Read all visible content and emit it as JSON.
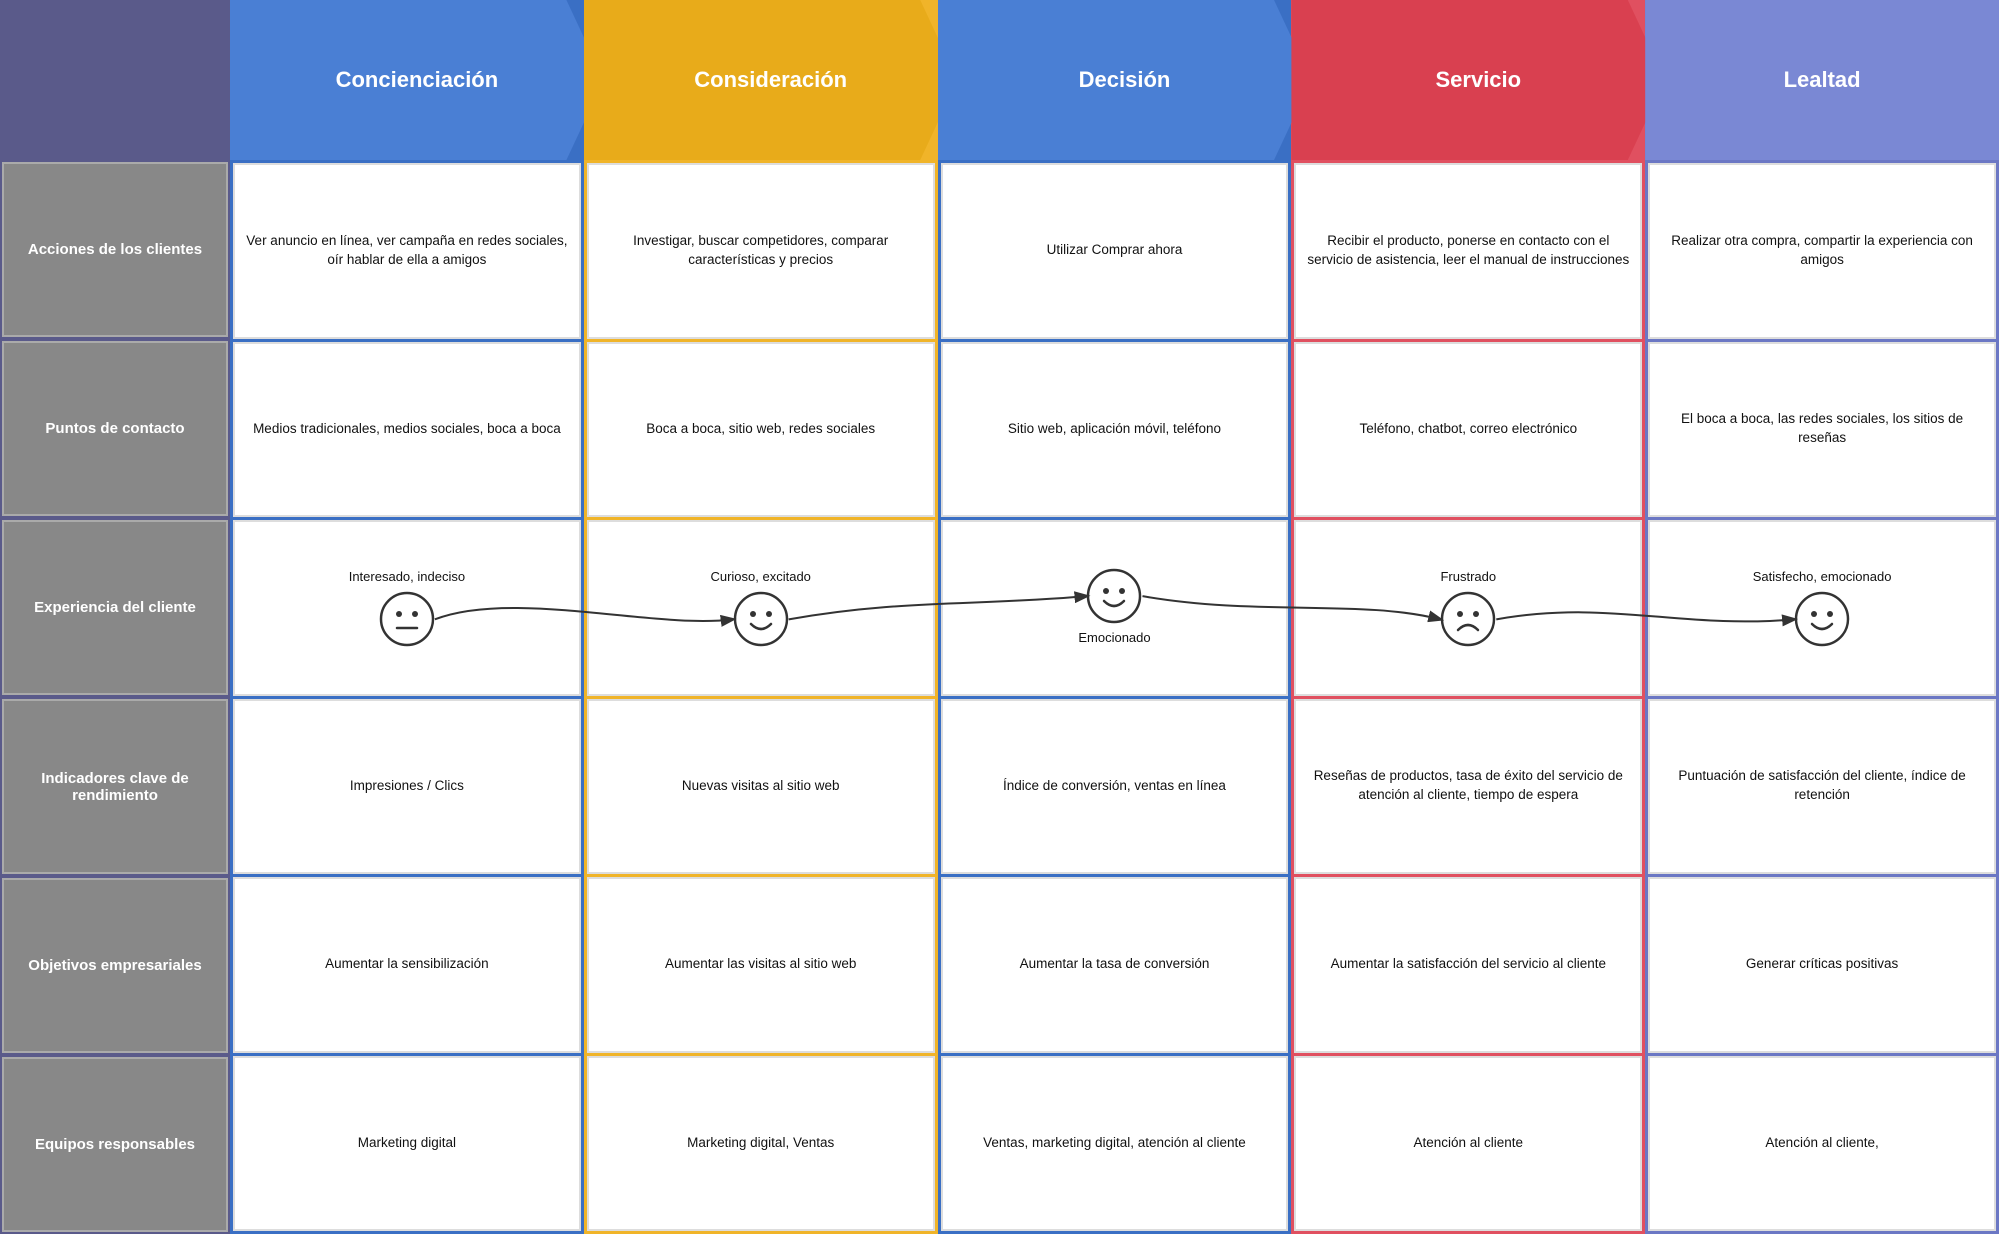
{
  "stages": [
    {
      "id": "concienciacion",
      "label": "Concienciación",
      "colorClass": "col-blue",
      "rows": {
        "acciones": "Ver anuncio en línea, ver campaña en redes sociales, oír hablar de ella a amigos",
        "puntos": "Medios tradicionales, medios sociales, boca a boca",
        "emotion_label": "Interesado, indeciso",
        "emotion_face": "neutral",
        "emotion_position": "bottom",
        "indicadores": "Impresiones / Clics",
        "objetivos": "Aumentar la sensibilización",
        "equipos": "Marketing digital"
      }
    },
    {
      "id": "consideracion",
      "label": "Consideración",
      "colorClass": "col-yellow",
      "rows": {
        "acciones": "Investigar, buscar competidores, comparar características y precios",
        "puntos": "Boca a boca, sitio web, redes sociales",
        "emotion_label": "Curioso, excitado",
        "emotion_face": "happy",
        "emotion_position": "bottom",
        "indicadores": "Nuevas visitas al sitio web",
        "objetivos": "Aumentar las visitas al sitio web",
        "equipos": "Marketing digital, Ventas"
      }
    },
    {
      "id": "decision",
      "label": "Decisión",
      "colorClass": "col-blue2",
      "rows": {
        "acciones": "Utilizar Comprar ahora",
        "puntos": "Sitio web, aplicación móvil, teléfono",
        "emotion_label": "Emocionado",
        "emotion_face": "happy",
        "emotion_position": "top",
        "indicadores": "Índice de conversión, ventas en línea",
        "objetivos": "Aumentar la tasa de conversión",
        "equipos": "Ventas, marketing digital, atención al cliente"
      }
    },
    {
      "id": "servicio",
      "label": "Servicio",
      "colorClass": "col-red",
      "rows": {
        "acciones": "Recibir el producto, ponerse en contacto con el servicio de asistencia, leer el manual de instrucciones",
        "puntos": "Teléfono, chatbot, correo electrónico",
        "emotion_label_top": "Frustrado",
        "emotion_label_bottom": "",
        "emotion_face_top": "sad",
        "emotion_face_bottom": "sad",
        "indicadores": "Reseñas de productos, tasa de éxito del servicio de atención al cliente, tiempo de espera",
        "objetivos": "Aumentar la satisfacción del servicio al cliente",
        "equipos": "Atención al cliente"
      }
    },
    {
      "id": "lealtad",
      "label": "Lealtad",
      "colorClass": "col-purple",
      "rows": {
        "acciones": "Realizar otra compra, compartir la experiencia con amigos",
        "puntos": "El boca a boca, las redes sociales, los sitios de reseñas",
        "emotion_label": "Satisfecho, emocionado",
        "emotion_face": "happy",
        "emotion_position": "right",
        "indicadores": "Puntuación de satisfacción del cliente, índice de retención",
        "objetivos": "Generar críticas positivas",
        "equipos": "Atención al cliente,"
      }
    }
  ],
  "row_labels": [
    "Acciones de los clientes",
    "Puntos de contacto",
    "Experiencia del cliente",
    "Indicadores clave de rendimiento",
    "Objetivos empresariales",
    "Equipos responsables"
  ]
}
